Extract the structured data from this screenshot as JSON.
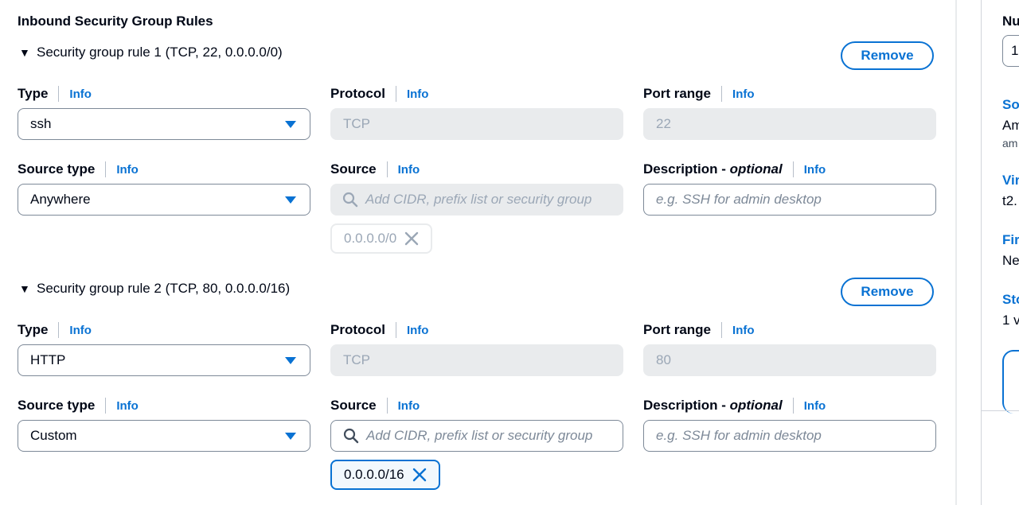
{
  "section": {
    "title": "Inbound Security Group Rules"
  },
  "labels": {
    "type": "Type",
    "protocol": "Protocol",
    "port_range": "Port range",
    "source_type": "Source type",
    "source": "Source",
    "description_main": "Description - ",
    "description_optional": "optional",
    "info": "Info",
    "remove": "Remove",
    "source_placeholder": "Add CIDR, prefix list or security group",
    "description_placeholder": "e.g. SSH for admin desktop"
  },
  "rules": [
    {
      "title": "Security group rule 1 (TCP, 22, 0.0.0.0/0)",
      "type": "ssh",
      "protocol": "TCP",
      "port_range": "22",
      "source_type": "Anywhere",
      "source_token": "0.0.0.0/0",
      "source_disabled": true
    },
    {
      "title": "Security group rule 2 (TCP, 80, 0.0.0.0/16)",
      "type": "HTTP",
      "protocol": "TCP",
      "port_range": "80",
      "source_type": "Custom",
      "source_token": "0.0.0.0/16",
      "source_disabled": false
    }
  ],
  "side_panel": {
    "number_label": "Nu",
    "number_value": "1",
    "software_label": "So",
    "software_value": "Am",
    "software_sub": "am",
    "virtual_label": "Vir",
    "virtual_value": "t2.",
    "firewall_label": "Fir",
    "firewall_value": "Ne",
    "storage_label": "Sto",
    "storage_value": "1 v"
  },
  "colors": {
    "accent": "#0972d3",
    "disabled_bg": "#e9ebed",
    "text": "#000716"
  }
}
